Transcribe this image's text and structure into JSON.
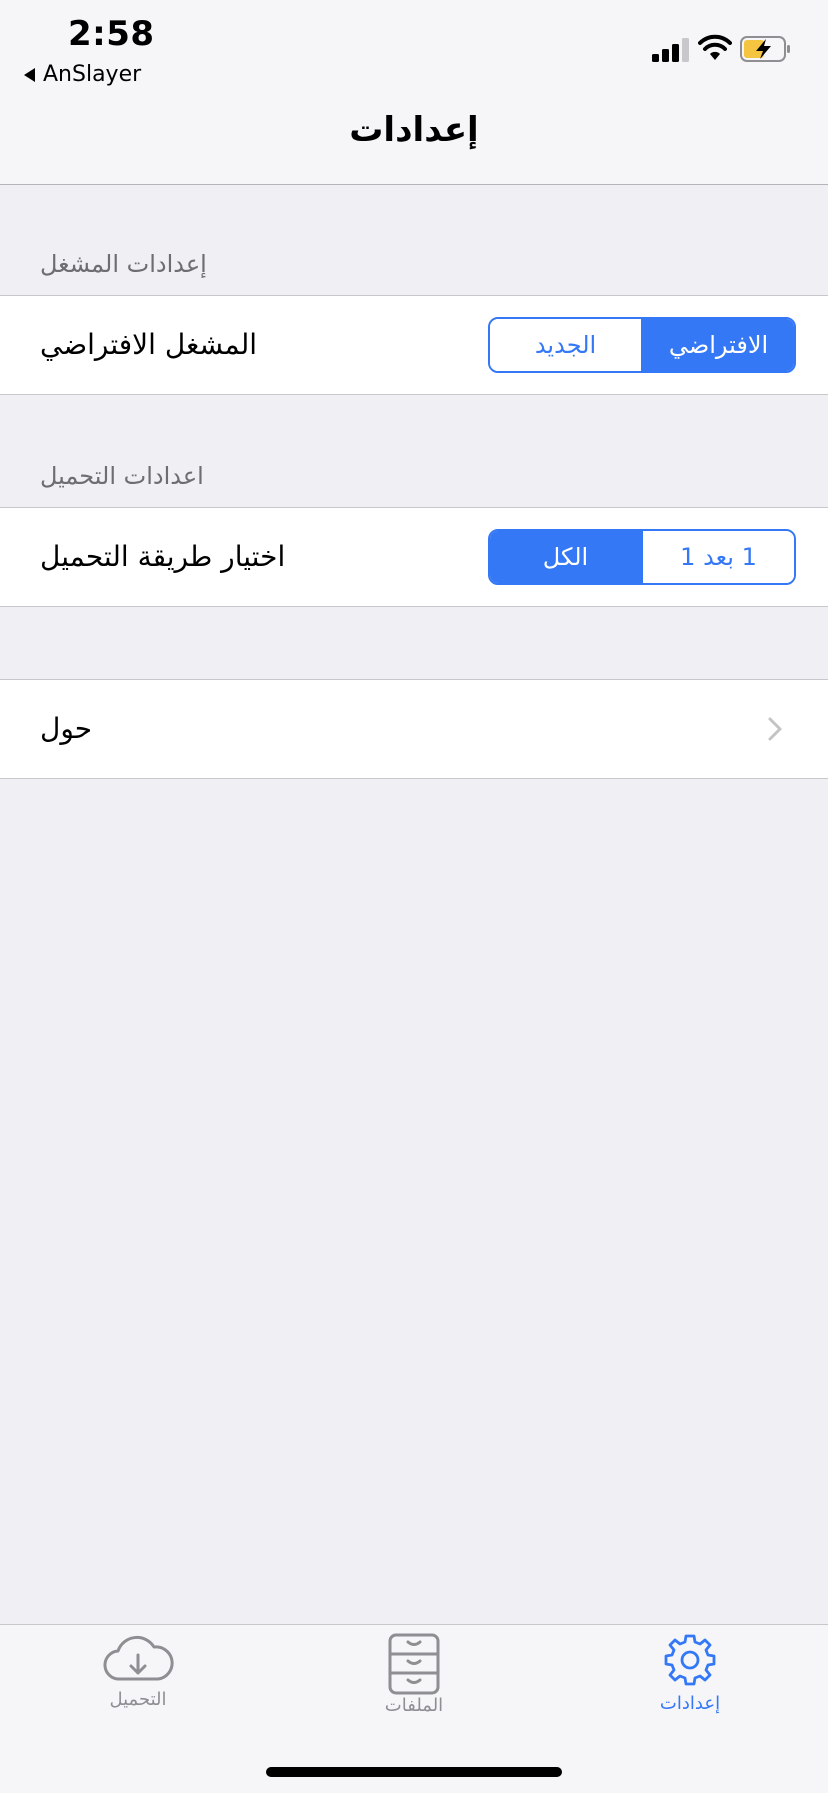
{
  "status_bar": {
    "time": "2:58",
    "back_app": "AnSlayer",
    "battery_charging": true
  },
  "nav": {
    "title": "إعدادات"
  },
  "sections": {
    "player": {
      "header": "إعدادات المشغل",
      "label": "المشغل الافتراضي",
      "options": [
        "الجديد",
        "الافتراضي"
      ],
      "selected": "الافتراضي"
    },
    "download": {
      "header": "اعدادات التحميل",
      "label": "اختيار طريقة التحميل",
      "options": [
        "الكل",
        "1 بعد 1"
      ],
      "selected": "الكل"
    },
    "about": {
      "label": "حول"
    }
  },
  "tab_bar": {
    "items": [
      {
        "label": "التحميل",
        "icon": "cloud-download-icon",
        "active": false
      },
      {
        "label": "الملفات",
        "icon": "file-cabinet-icon",
        "active": false
      },
      {
        "label": "إعدادات",
        "icon": "gear-icon",
        "active": true
      }
    ]
  },
  "colors": {
    "accent": "#3478f6",
    "background": "#efeff4",
    "inactive": "#8e8e93"
  }
}
